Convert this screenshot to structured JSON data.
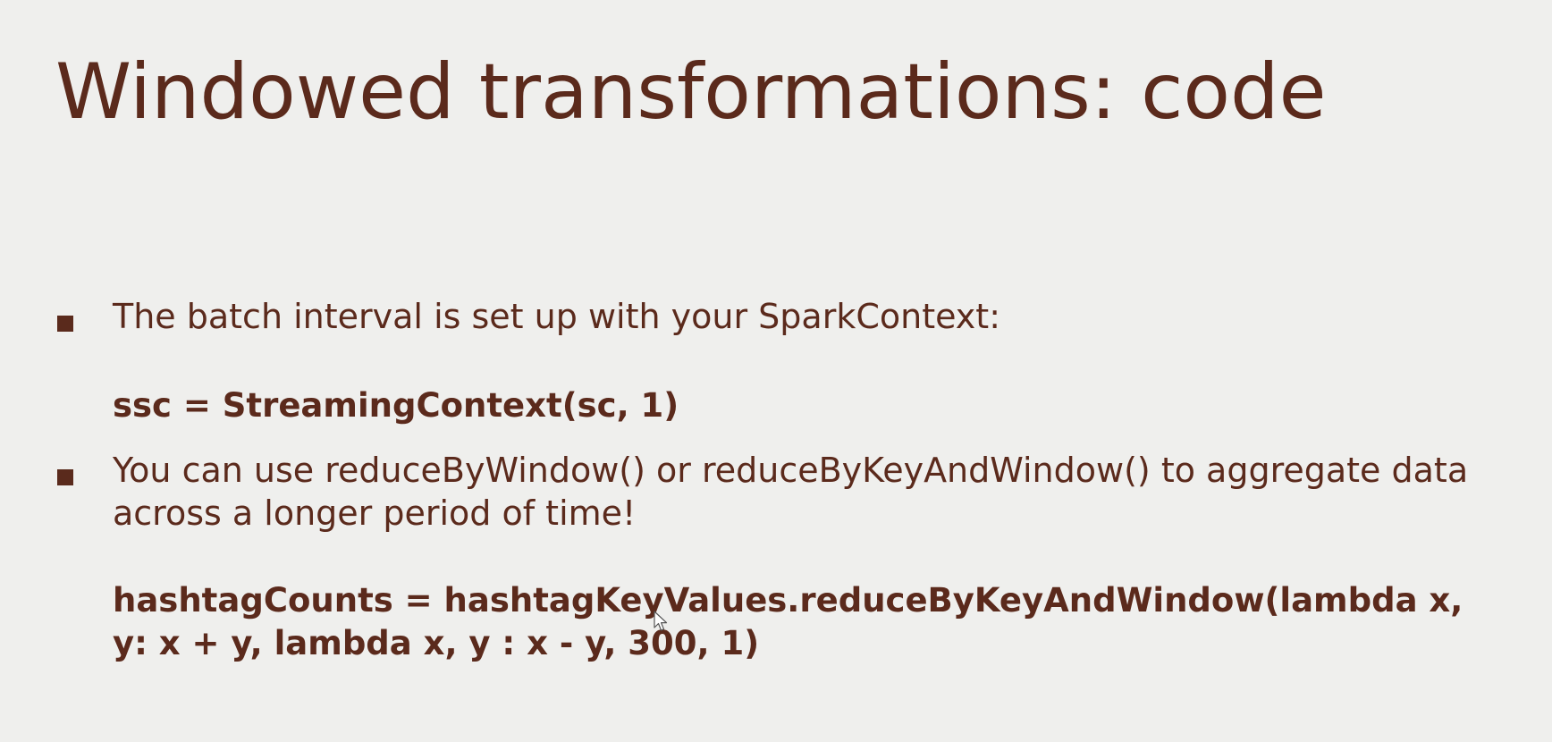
{
  "slide": {
    "title": "Windowed transformations: code",
    "bullets": [
      {
        "text": "The batch interval is set up with your SparkContext:",
        "code": "ssc = StreamingContext(sc, 1)"
      },
      {
        "text": "You can use reduceByWindow() or reduceByKeyAndWindow() to aggregate data across a longer period of time!",
        "code": "hashtagCounts = hashtagKeyValues.reduceByKeyAndWindow(lambda x, y: x + y, lambda x, y : x - y, 300, 1)"
      }
    ]
  },
  "icons": {
    "bullet": "square-bullet-icon",
    "cursor": "mouse-pointer-icon"
  },
  "colors": {
    "background": "#efefed",
    "text": "#5b2a1c"
  }
}
